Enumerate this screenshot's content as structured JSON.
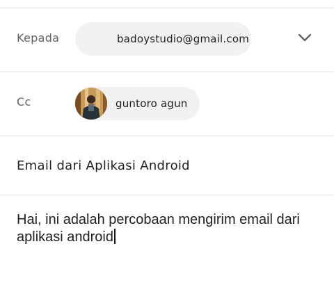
{
  "to": {
    "label": "Kepada",
    "recipient": "badoystudio@gmail.com",
    "expand_icon": "chevron-down-icon"
  },
  "cc": {
    "label": "Cc",
    "recipient": "guntoro agun",
    "avatar": "user-avatar-photo"
  },
  "subject": "Email dari Aplikasi Android",
  "body": "Hai, ini adalah percobaan mengirim email dari aplikasi android",
  "colors": {
    "chip_bg": "#f1f1f1",
    "divider": "#e3e3e3",
    "label": "#5f6368",
    "text": "#202124"
  }
}
